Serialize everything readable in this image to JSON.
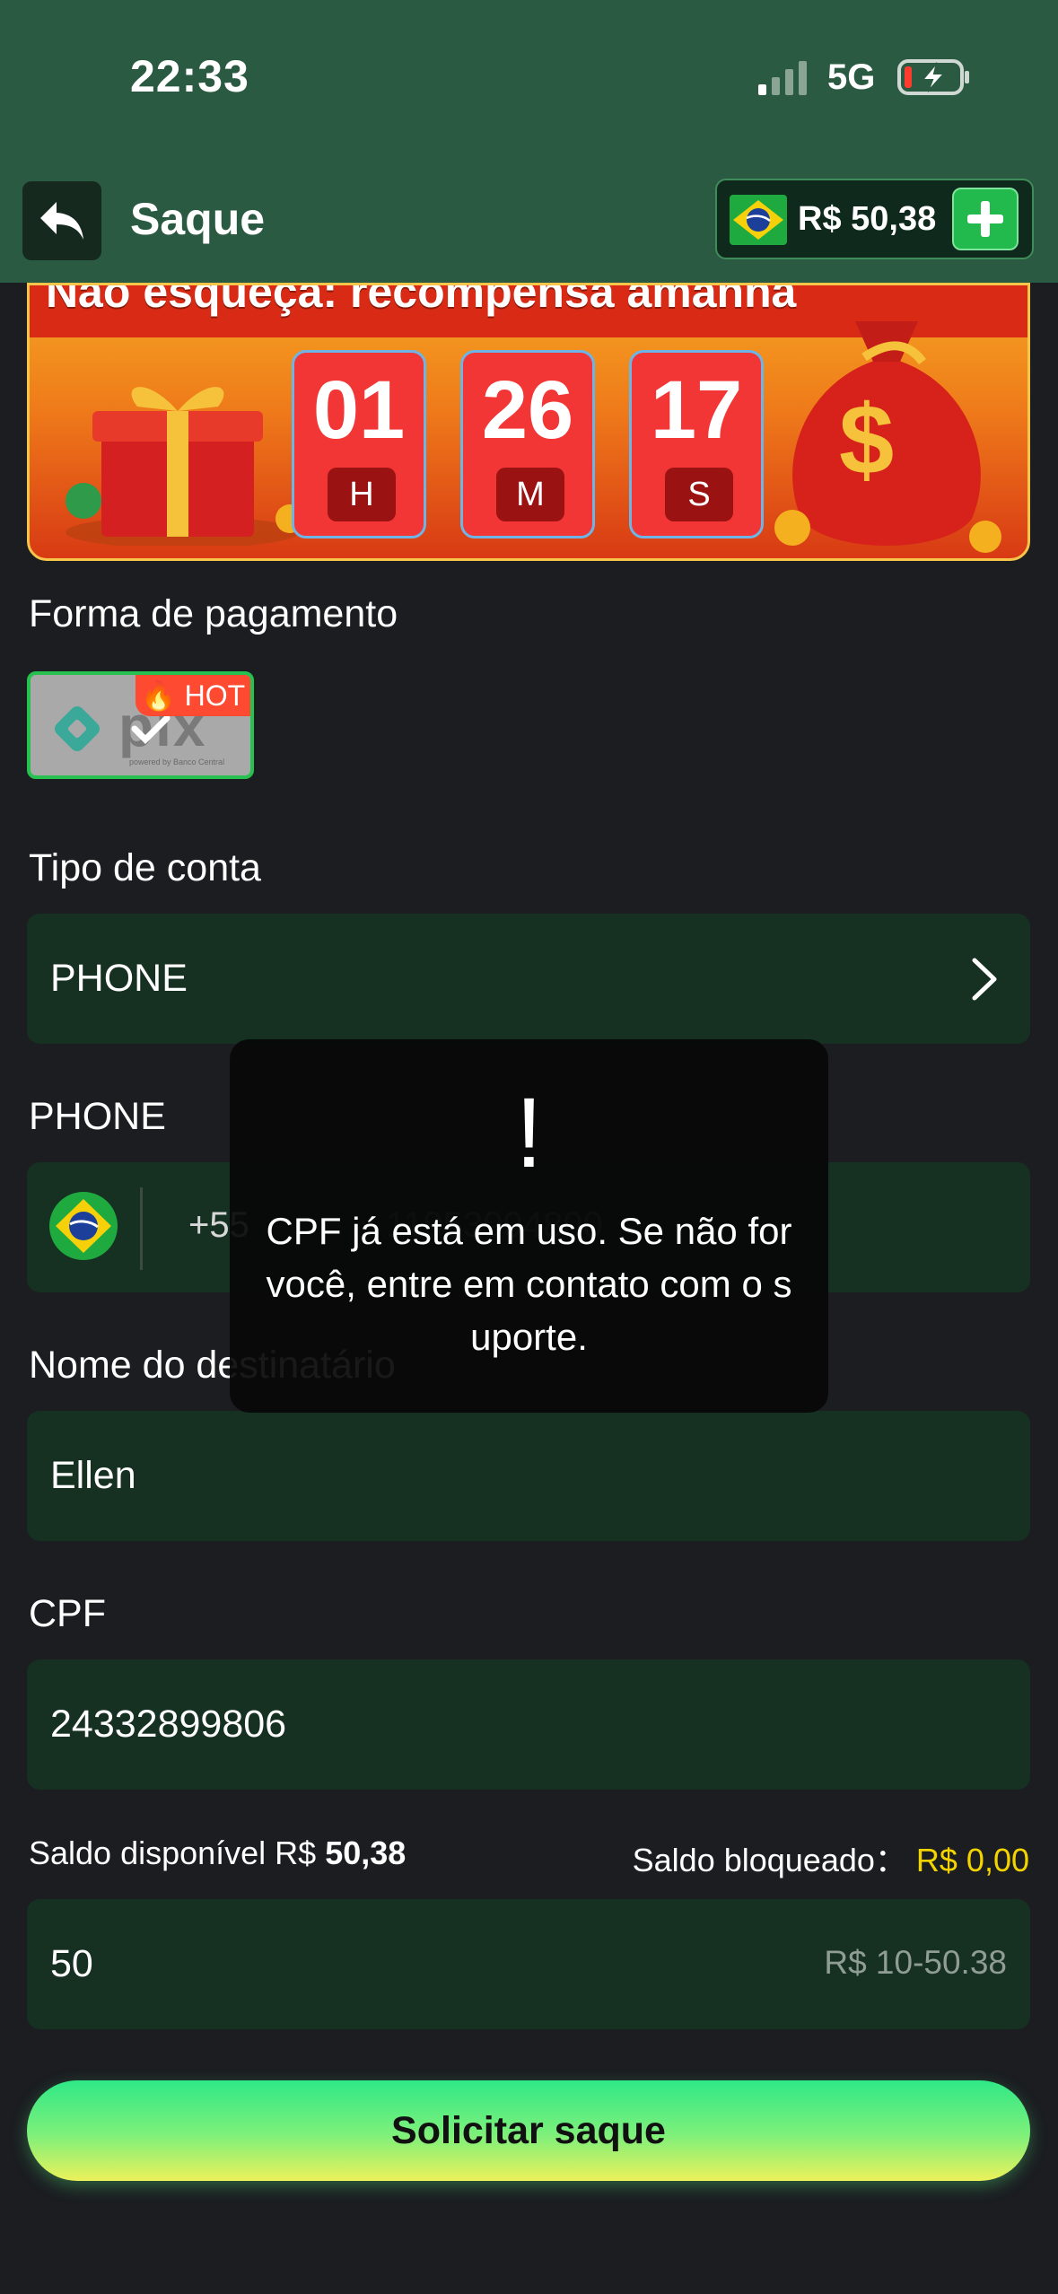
{
  "status_bar": {
    "time": "22:33",
    "network": "5G"
  },
  "header": {
    "title": "Saque",
    "balance": "R$ 50,38"
  },
  "banner": {
    "title": "Não esqueça: recompensa amanhã",
    "countdown": [
      {
        "value": "01",
        "unit": "H"
      },
      {
        "value": "26",
        "unit": "M"
      },
      {
        "value": "17",
        "unit": "S"
      }
    ]
  },
  "payment": {
    "label": "Forma de pagamento",
    "method": "pix",
    "method_sub": "powered by Banco Central",
    "hot_badge": "HOT"
  },
  "account_type": {
    "label": "Tipo de conta",
    "value": "PHONE"
  },
  "phone": {
    "label": "PHONE",
    "country_code": "+55",
    "number": "11953994800"
  },
  "recipient": {
    "label": "Nome do destinatário",
    "value": "Ellen"
  },
  "cpf": {
    "label": "CPF",
    "value": "24332899806"
  },
  "balance_info": {
    "available_label": "Saldo disponível R$",
    "available_value": "50,38",
    "blocked_label": "Saldo bloqueado：",
    "blocked_value": "R$ 0,00"
  },
  "amount": {
    "value": "50",
    "range_hint": "R$ 10-50.38"
  },
  "submit_label": "Solicitar saque",
  "toast": {
    "icon": "!",
    "message": "CPF já está em uso. Se não for você, entre em contato com o suporte."
  },
  "colors": {
    "header_bg": "#2b5a42",
    "field_bg": "#163022",
    "page_bg": "#1b1d21",
    "accent_green": "#27c14f",
    "blocked_yellow": "#f3d400"
  }
}
